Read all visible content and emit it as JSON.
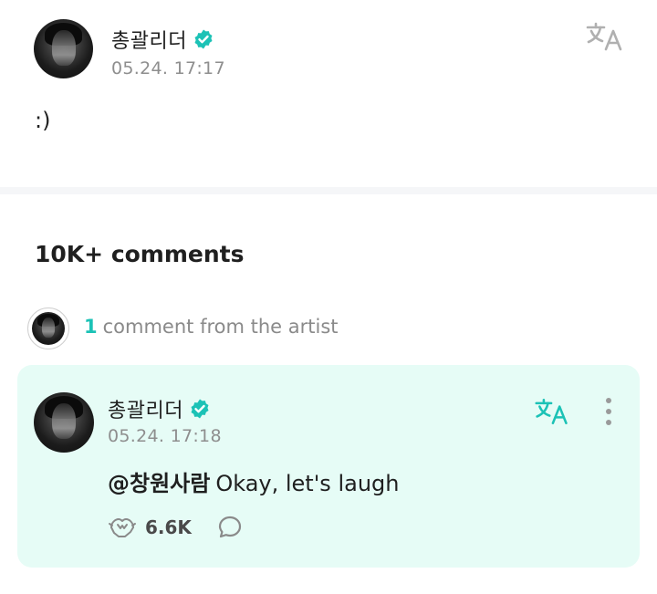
{
  "post": {
    "author": "총괄리더",
    "date": "05.24. 17:17",
    "body": ":)",
    "translate_icon": "translate-icon",
    "verified_icon": "verified-badge-icon"
  },
  "comments": {
    "count_label": "10K+ comments",
    "artist_count": "1",
    "artist_label": "comment from the artist"
  },
  "artist_comment": {
    "author": "총괄리더",
    "date": "05.24. 17:18",
    "mention": "@창원사람",
    "text": "Okay, let's laugh",
    "likes": "6.6K",
    "like_icon": "heart-hands-icon",
    "reply_icon": "comment-bubble-icon",
    "more_icon": "more-vertical-icon"
  },
  "colors": {
    "accent": "#1cc2b6",
    "card_background": "#e6fcf6",
    "muted_text": "#8e8e8e"
  }
}
